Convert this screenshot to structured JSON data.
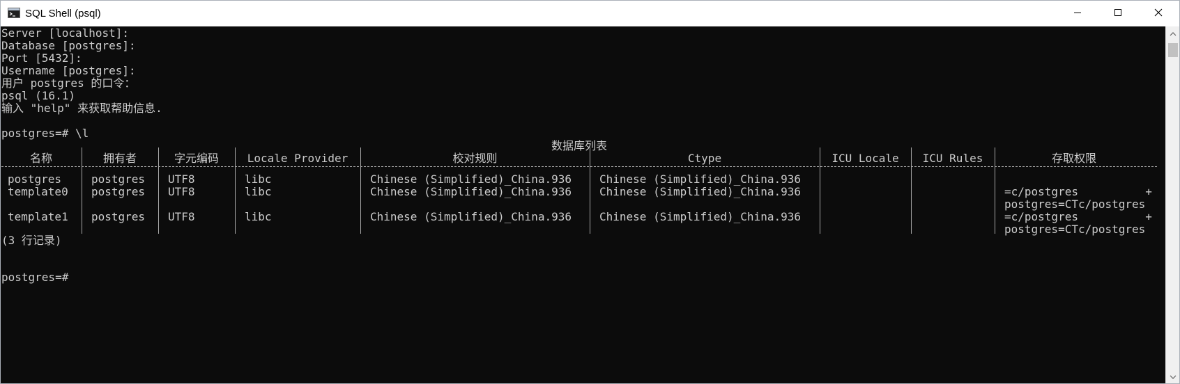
{
  "window": {
    "title": "SQL Shell (psql)",
    "icon": "console-icon"
  },
  "controls": {
    "minimize": "minimize-icon",
    "maximize": "maximize-icon",
    "close": "close-icon"
  },
  "console": {
    "login": [
      "Server [localhost]:",
      "Database [postgres]:",
      "Port [5432]:",
      "Username [postgres]:",
      "用户 postgres 的口令：",
      "psql (16.1)",
      "输入 \"help\" 来获取帮助信息."
    ],
    "command": "postgres=# \\l",
    "table": {
      "title": "数据库列表",
      "headers": [
        "名称",
        "拥有者",
        "字元编码",
        "Locale Provider",
        "校对规则",
        "Ctype",
        "ICU Locale",
        "ICU Rules",
        "存取权限"
      ],
      "rows": [
        {
          "name": "postgres",
          "owner": "postgres",
          "encoding": "UTF8",
          "provider": "libc",
          "collate": "Chinese (Simplified)_China.936",
          "ctype": "Chinese (Simplified)_China.936",
          "icu_locale": "",
          "icu_rules": "",
          "access": [
            "",
            ""
          ]
        },
        {
          "name": "template0",
          "owner": "postgres",
          "encoding": "UTF8",
          "provider": "libc",
          "collate": "Chinese (Simplified)_China.936",
          "ctype": "Chinese (Simplified)_China.936",
          "icu_locale": "",
          "icu_rules": "",
          "access": [
            "=c/postgres          +",
            "postgres=CTc/postgres"
          ]
        },
        {
          "name": "template1",
          "owner": "postgres",
          "encoding": "UTF8",
          "provider": "libc",
          "collate": "Chinese (Simplified)_China.936",
          "ctype": "Chinese (Simplified)_China.936",
          "icu_locale": "",
          "icu_rules": "",
          "access": [
            "=c/postgres          +",
            "postgres=CTc/postgres"
          ]
        }
      ],
      "footer": "(3 行记录)"
    },
    "prompt": "postgres=#"
  },
  "colors": {
    "background": "#0c0c0c",
    "text": "#cccccc",
    "titlebar": "#ffffff"
  }
}
